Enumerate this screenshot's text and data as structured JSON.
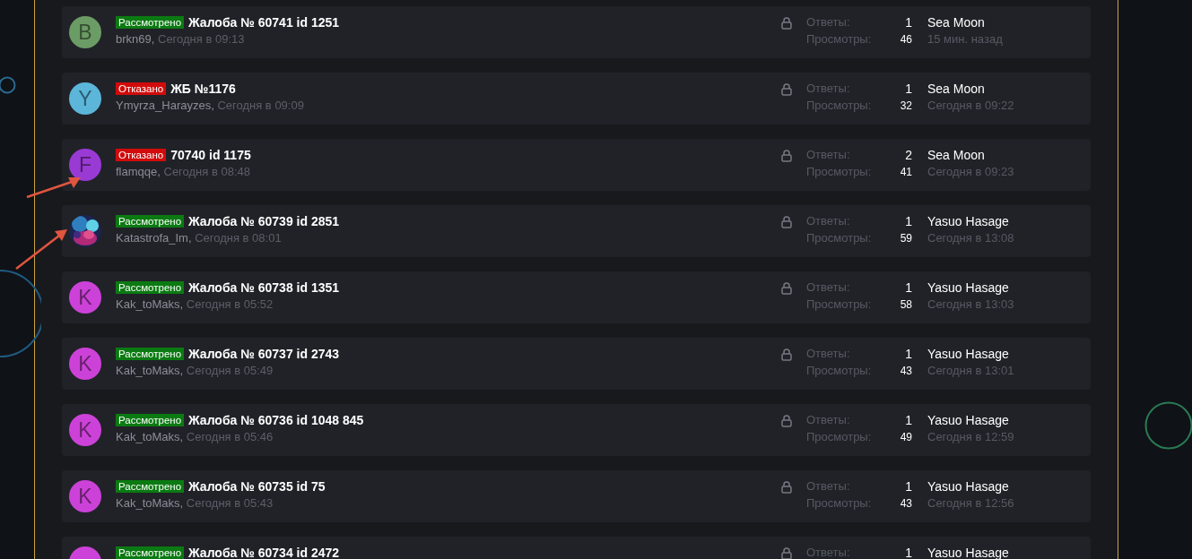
{
  "threads": [
    {
      "avatar": {
        "kind": "letter",
        "letter": "B",
        "color": "#6c9c65"
      },
      "status": {
        "kind": "reviewed",
        "label": "Рассмотрено"
      },
      "title": "Жалоба № 60741 id 1251",
      "author": "brkn69,",
      "date": "Сегодня в 09:13",
      "locked": true,
      "replies_label": "Ответы:",
      "replies": "1",
      "views_label": "Просмотры:",
      "views": "46",
      "last_poster": "Sea Moon",
      "last_date": "15 мин. назад"
    },
    {
      "avatar": {
        "kind": "letter",
        "letter": "Y",
        "color": "#5bb6da"
      },
      "status": {
        "kind": "rejected",
        "label": "Отказано"
      },
      "title": "ЖБ №1176",
      "author": "Ymyrza_Harayzes,",
      "date": "Сегодня в 09:09",
      "locked": true,
      "replies_label": "Ответы:",
      "replies": "1",
      "views_label": "Просмотры:",
      "views": "32",
      "last_poster": "Sea Moon",
      "last_date": "Сегодня в 09:22"
    },
    {
      "avatar": {
        "kind": "letter",
        "letter": "F",
        "color": "#9a3ad4"
      },
      "status": {
        "kind": "rejected",
        "label": "Отказано"
      },
      "title": "70740 id 1175",
      "author": "flamqqe,",
      "date": "Сегодня в 08:48",
      "locked": true,
      "replies_label": "Ответы:",
      "replies": "2",
      "views_label": "Просмотры:",
      "views": "41",
      "last_poster": "Sea Moon",
      "last_date": "Сегодня в 09:23"
    },
    {
      "status": {
        "kind": "reviewed",
        "label": "Рассмотрено"
      },
      "title": "Жалоба № 60739 id 2851",
      "author": "Katastrofa_Im,",
      "date": "Сегодня в 08:01",
      "locked": true,
      "replies_label": "Ответы:",
      "replies": "1",
      "views_label": "Просмотры:",
      "views": "59",
      "last_poster": "Yasuo Hasage",
      "last_date": "Сегодня в 13:08"
    },
    {
      "avatar": {
        "kind": "letter",
        "letter": "K",
        "color": "#cc42d8"
      },
      "status": {
        "kind": "reviewed",
        "label": "Рассмотрено"
      },
      "title": "Жалоба № 60738 id 1351",
      "author": "Kak_toMaks,",
      "date": "Сегодня в 05:52",
      "locked": true,
      "replies_label": "Ответы:",
      "replies": "1",
      "views_label": "Просмотры:",
      "views": "58",
      "last_poster": "Yasuo Hasage",
      "last_date": "Сегодня в 13:03"
    },
    {
      "avatar": {
        "kind": "letter",
        "letter": "K",
        "color": "#cc42d8"
      },
      "status": {
        "kind": "reviewed",
        "label": "Рассмотрено"
      },
      "title": "Жалоба № 60737 id 2743",
      "author": "Kak_toMaks,",
      "date": "Сегодня в 05:49",
      "locked": true,
      "replies_label": "Ответы:",
      "replies": "1",
      "views_label": "Просмотры:",
      "views": "43",
      "last_poster": "Yasuo Hasage",
      "last_date": "Сегодня в 13:01"
    },
    {
      "avatar": {
        "kind": "letter",
        "letter": "K",
        "color": "#cc42d8"
      },
      "status": {
        "kind": "reviewed",
        "label": "Рассмотрено"
      },
      "title": "Жалоба № 60736 id 1048 845",
      "author": "Kak_toMaks,",
      "date": "Сегодня в 05:46",
      "locked": true,
      "replies_label": "Ответы:",
      "replies": "1",
      "views_label": "Просмотры:",
      "views": "49",
      "last_poster": "Yasuo Hasage",
      "last_date": "Сегодня в 12:59"
    },
    {
      "avatar": {
        "kind": "letter",
        "letter": "K",
        "color": "#cc42d8"
      },
      "status": {
        "kind": "reviewed",
        "label": "Рассмотрено"
      },
      "title": "Жалоба № 60735 id 75",
      "author": "Kak_toMaks,",
      "date": "Сегодня в 05:43",
      "locked": true,
      "replies_label": "Ответы:",
      "replies": "1",
      "views_label": "Просмотры:",
      "views": "43",
      "last_poster": "Yasuo Hasage",
      "last_date": "Сегодня в 12:56"
    },
    {
      "avatar": {
        "kind": "letter",
        "color": "#cc42d8"
      },
      "status": {
        "kind": "reviewed",
        "label": "Рассмотрено"
      },
      "title": "Жалоба № 60734 id 2472",
      "locked": true,
      "replies_label": "Ответы:",
      "replies": "1",
      "last_poster": "Yasuo Hasage"
    }
  ]
}
